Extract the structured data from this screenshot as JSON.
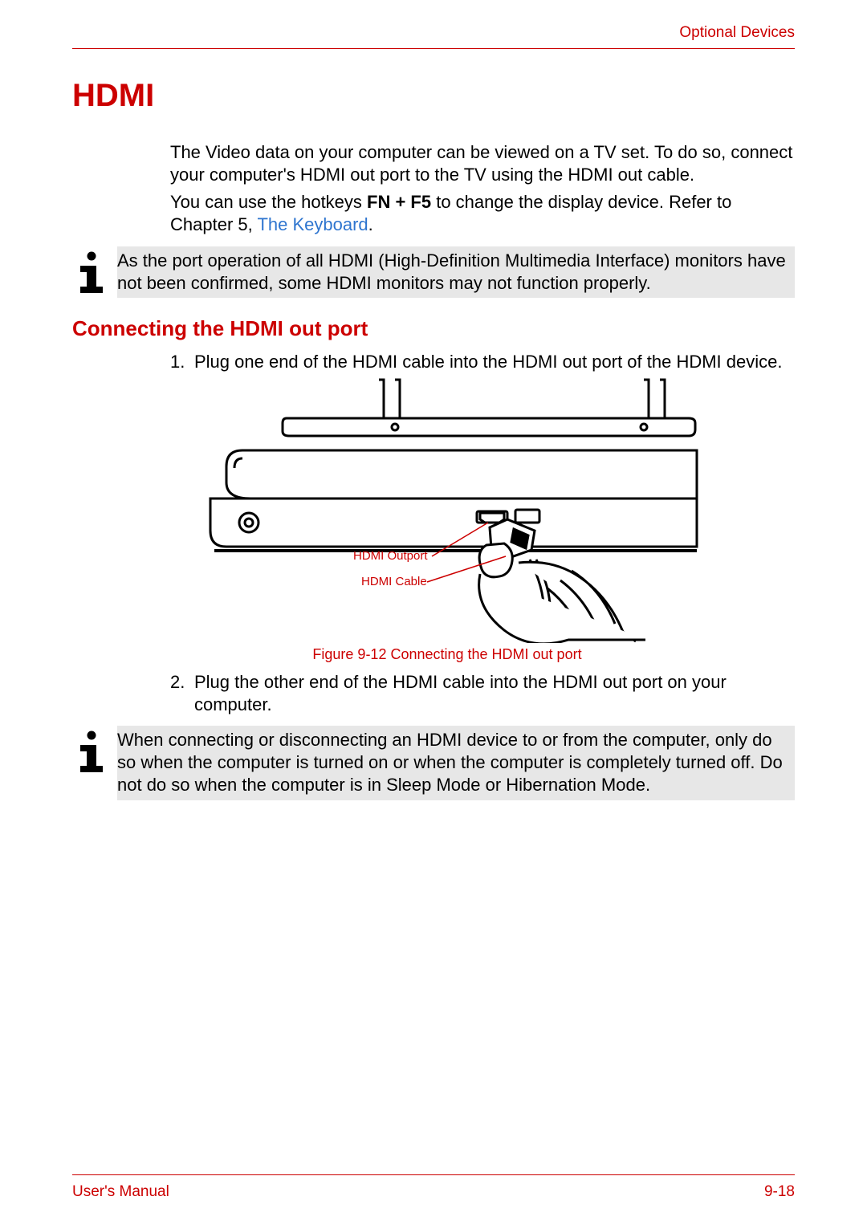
{
  "header": {
    "section": "Optional Devices"
  },
  "title": "HDMI",
  "intro": {
    "p1": "The Video data on your computer can be viewed on a TV set. To do so, connect your computer's HDMI out port to the TV using the HDMI out cable.",
    "p2a": "You can use the hotkeys ",
    "p2_bold": "FN + F5",
    "p2b": " to change the display device. Refer to Chapter 5, ",
    "p2_link": "The Keyboard",
    "p2c": "."
  },
  "note1": "As the port operation of all HDMI (High-Definition Multimedia Interface) monitors have not been confirmed, some HDMI monitors may not function properly.",
  "subheading": "Connecting the HDMI out port",
  "steps": {
    "s1_num": "1.",
    "s1": "Plug one end of the HDMI cable into the HDMI out port of the HDMI device.",
    "s2_num": "2.",
    "s2": "Plug the other end of the HDMI cable into the HDMI out port on your computer."
  },
  "figure": {
    "label_outport": "HDMI Outport",
    "label_cable": "HDMI Cable",
    "caption": "Figure 9-12 Connecting the HDMI out port"
  },
  "note2": "When connecting or disconnecting an HDMI device to or from the computer, only do so when the computer is turned on or when the computer is completely turned off. Do not do so when the computer is in Sleep Mode or Hibernation Mode.",
  "footer": {
    "left": "User's Manual",
    "right": "9-18"
  }
}
